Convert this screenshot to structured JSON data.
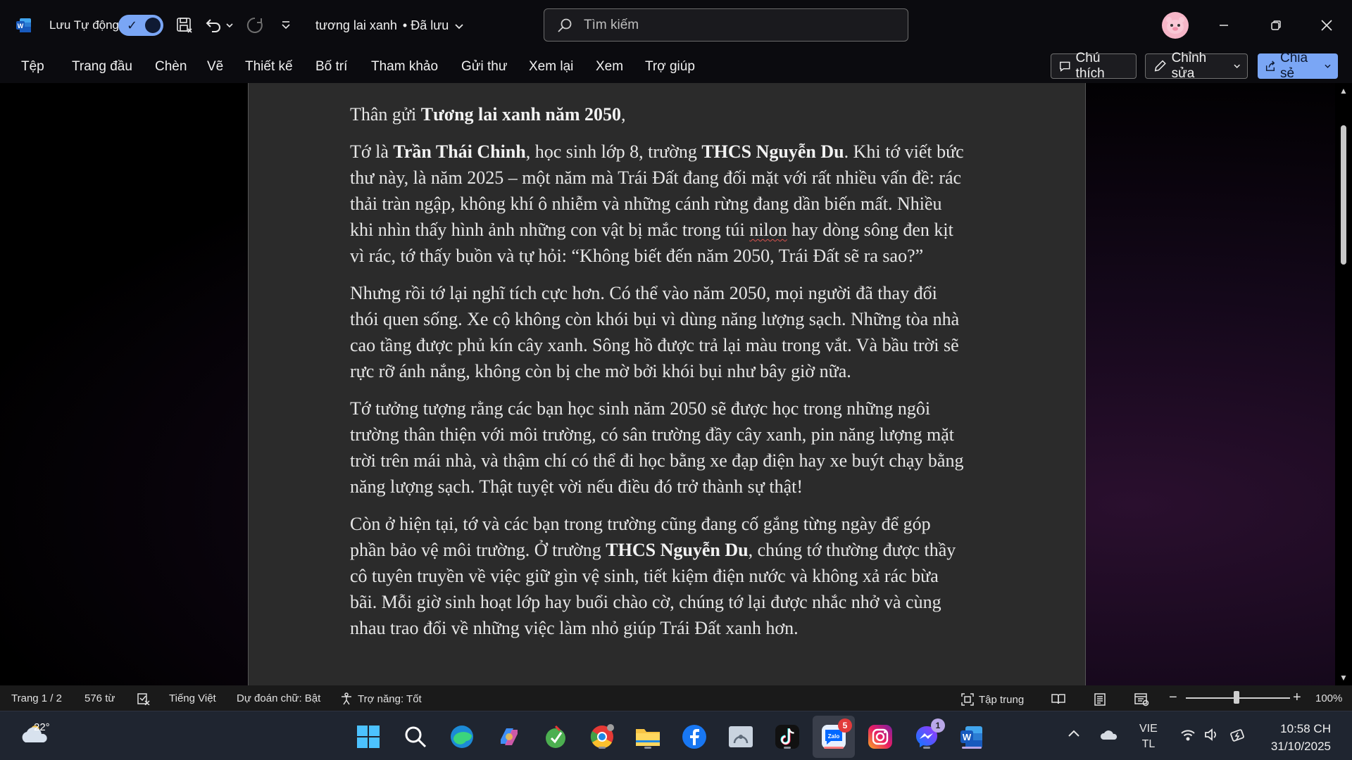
{
  "titlebar": {
    "autosave_label": "Lưu Tự động",
    "doc_name": "tương lai xanh",
    "save_state": "• Đã lưu",
    "search_placeholder": "Tìm kiếm"
  },
  "ribbon": {
    "tabs": [
      "Tệp",
      "Trang đầu",
      "Chèn",
      "Vẽ",
      "Thiết kế",
      "Bố trí",
      "Tham khảo",
      "Gửi thư",
      "Xem lại",
      "Xem",
      "Trợ giúp"
    ],
    "comments_label": "Chú thích",
    "editing_label": "Chỉnh sửa",
    "share_label": "Chia sẻ"
  },
  "document": {
    "p1": {
      "a": "Thân gửi ",
      "b": "Tương lai xanh năm 2050",
      "c": ","
    },
    "p2": {
      "a": "Tớ là ",
      "b": "Trần Thái Chinh",
      "c": ", học sinh lớp 8, trường ",
      "d": "THCS Nguyễn Du",
      "e": ". Khi tớ viết bức thư này, là năm 2025 – một năm mà Trái Đất đang đối mặt với rất nhiều vấn đề: rác thải tràn ngập, không khí ô nhiễm và những cánh rừng đang dần biến mất. Nhiều khi nhìn thấy hình ảnh những con vật bị mắc trong túi ",
      "f": "nilon",
      "g": " hay dòng sông đen kịt vì rác, tớ thấy buồn và tự hỏi: “Không biết đến năm 2050, Trái Đất sẽ ra sao?”"
    },
    "p3": "Nhưng rồi tớ lại nghĩ tích cực hơn. Có thể vào năm 2050, mọi người đã thay đổi thói quen sống. Xe cộ không còn khói bụi vì dùng năng lượng sạch. Những tòa nhà cao tầng được phủ kín cây xanh. Sông hồ được trả lại màu trong vắt. Và bầu trời sẽ rực rỡ ánh nắng, không còn bị che mờ bởi khói bụi như bây giờ nữa.",
    "p4": "Tớ tưởng tượng rằng các bạn học sinh năm 2050 sẽ được học trong những ngôi trường thân thiện với môi trường, có sân trường đầy cây xanh, pin năng lượng mặt trời trên mái nhà, và thậm chí có thể đi học bằng xe đạp điện hay xe buýt chạy bằng năng lượng sạch. Thật tuyệt vời nếu điều đó trở thành sự thật!",
    "p5": {
      "a": "Còn ở hiện tại, tớ và các bạn trong trường cũng đang cố gắng từng ngày để góp phần bảo vệ môi trường. Ở trường ",
      "b": "THCS Nguyễn Du",
      "c": ", chúng tớ thường được thầy cô tuyên truyền về việc giữ gìn vệ sinh, tiết kiệm điện nước và không xả rác bừa bãi. Mỗi giờ sinh hoạt lớp hay buổi chào cờ, chúng tớ lại được nhắc nhở và cùng nhau trao đổi về những việc làm nhỏ giúp Trái Đất xanh hơn."
    }
  },
  "statusbar": {
    "page": "Trang 1 / 2",
    "words": "576 từ",
    "language": "Tiếng Việt",
    "prediction": "Dự đoán chữ: Bật",
    "accessibility": "Trợ năng: Tốt",
    "focus": "Tập trung",
    "zoom": "100%"
  },
  "taskbar": {
    "temperature": "22°",
    "zalo_badge": "5",
    "messenger_badge": "1",
    "lang_top": "VIE",
    "lang_bottom": "TL",
    "time": "10:58 CH",
    "date": "31/10/2025"
  },
  "colors": {
    "accent": "#7aa6f5",
    "page": "#2b2b2b",
    "statusbar": "#1a1a1a",
    "taskbar": "#1f2530"
  }
}
